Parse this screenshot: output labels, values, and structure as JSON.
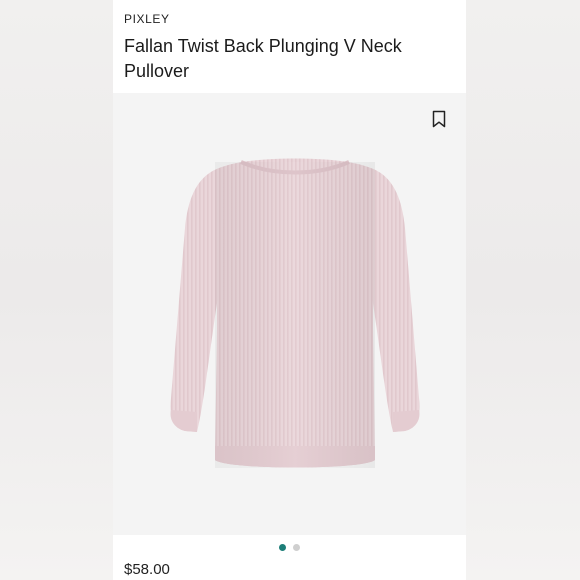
{
  "product": {
    "brand": "PIXLEY",
    "title": "Fallan Twist Back Plunging V Neck Pullover",
    "price": "$58.00",
    "image": {
      "subject": "sweater",
      "color": "#e9d3d8"
    }
  },
  "carousel": {
    "total": 2,
    "active_index": 0,
    "active_color": "#1d7e78",
    "inactive_color": "#cfcfcf"
  },
  "icons": {
    "bookmark": "bookmark-icon"
  }
}
